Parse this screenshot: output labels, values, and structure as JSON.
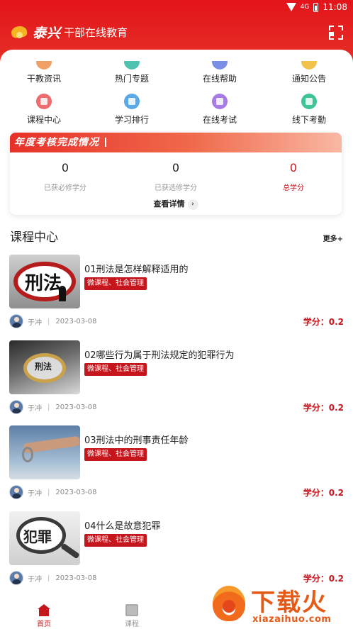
{
  "status": {
    "time": "11:08",
    "network": "4G"
  },
  "header": {
    "brand_calligraphy": "泰兴",
    "title": "干部在线教育"
  },
  "grid": [
    {
      "label": "干教资讯",
      "icon": "news-icon",
      "color": "#f0a064"
    },
    {
      "label": "热门专题",
      "icon": "topic-icon",
      "color": "#4fc3b0"
    },
    {
      "label": "在线帮助",
      "icon": "help-icon",
      "color": "#7b8ee6"
    },
    {
      "label": "通知公告",
      "icon": "notice-icon",
      "color": "#f2c34c"
    },
    {
      "label": "课程中心",
      "icon": "course-center-icon",
      "color": "#ee6b70"
    },
    {
      "label": "学习排行",
      "icon": "ranking-icon",
      "color": "#5aa9e6"
    },
    {
      "label": "在线考试",
      "icon": "exam-icon",
      "color": "#a77be6"
    },
    {
      "label": "线下考勤",
      "icon": "attendance-icon",
      "color": "#3fc49a"
    }
  ],
  "annual": {
    "banner": "年度考核完成情况",
    "stats": [
      {
        "value": "0",
        "label": "已获必修学分"
      },
      {
        "value": "0",
        "label": "已获选修学分"
      },
      {
        "value": "0",
        "label": "总学分"
      }
    ],
    "details": "查看详情",
    "chevron": "›"
  },
  "course_section": {
    "title": "课程中心",
    "more": "更多+"
  },
  "courses": [
    {
      "title": "01刑法是怎样解释适用的",
      "tag": "微课程、社会管理",
      "author": "于冲",
      "date": "2023-03-08",
      "credit": "学分：0.2",
      "thumb_text": "刑法"
    },
    {
      "title": "02哪些行为属于刑法规定的犯罪行为",
      "tag": "微课程、社会管理",
      "author": "于冲",
      "date": "2023-03-08",
      "credit": "学分：0.2",
      "thumb_text": "刑法"
    },
    {
      "title": "03刑法中的刑事责任年龄",
      "tag": "微课程、社会管理",
      "author": "于冲",
      "date": "2023-03-08",
      "credit": "学分：0.2"
    },
    {
      "title": "04什么是故意犯罪",
      "tag": "微课程、社会管理",
      "author": "于冲",
      "date": "2023-03-08",
      "credit": "学分：0.2",
      "thumb_text": "犯罪"
    }
  ],
  "meta_sep": "|",
  "tabs": [
    {
      "label": "首页"
    },
    {
      "label": "课程"
    }
  ],
  "watermark": {
    "text": "下载火",
    "url": "xiazaihuo.com"
  },
  "colors": {
    "brand_red": "#c5161d",
    "header_red": "#e3141a"
  }
}
